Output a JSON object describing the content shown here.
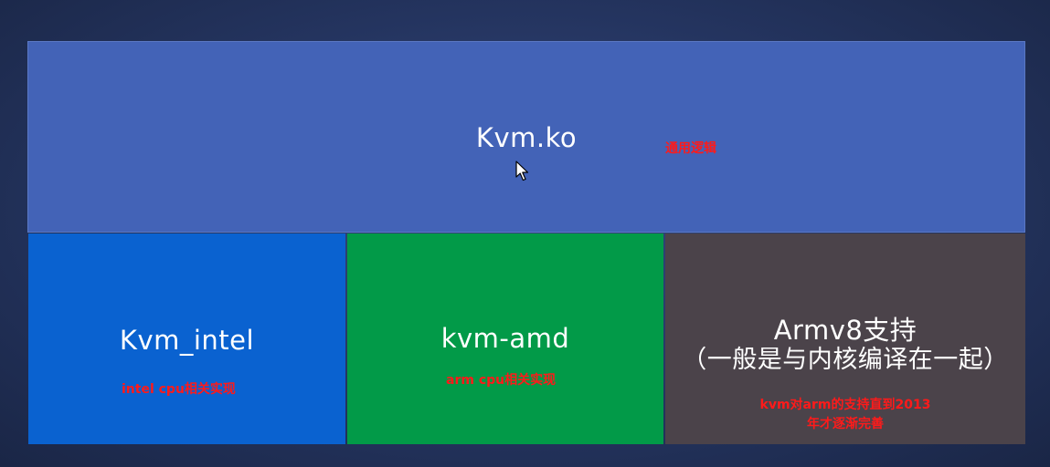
{
  "blocks": {
    "kvm": {
      "title": "Kvm.ko",
      "note": "通用逻辑"
    },
    "intel": {
      "title": "Kvm_intel",
      "note": "intel cpu相关实现"
    },
    "amd": {
      "title": "kvm-amd",
      "note": "arm cpu相关实现"
    },
    "arm": {
      "title": "Armv8支持",
      "subtitle": "（一般是与内核编译在一起）",
      "note_line1": "kvm对arm的支持直到2013",
      "note_line2": "年才逐渐完善"
    }
  },
  "colors": {
    "kvm_block": "#4363b7",
    "intel_block": "#0a62d0",
    "amd_block": "#029a48",
    "arm_block": "#4b434a",
    "annotation": "#ff1a1a"
  },
  "icons": {
    "cursor": "mouse-pointer-icon"
  }
}
